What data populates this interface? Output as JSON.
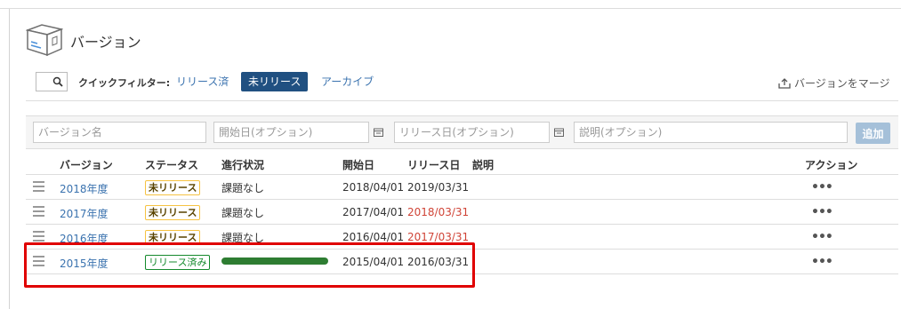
{
  "header": {
    "title": "バージョン",
    "icon": "box-icon"
  },
  "filter": {
    "label": "クイックフィルター:",
    "options": [
      {
        "label": "リリース済",
        "active": false
      },
      {
        "label": "未リリース",
        "active": true
      },
      {
        "label": "アーカイブ",
        "active": false
      }
    ]
  },
  "merge_label": "バージョンをマージ",
  "add_form": {
    "name_placeholder": "バージョン名",
    "start_placeholder": "開始日(オプション)",
    "release_placeholder": "リリース日(オプション)",
    "desc_placeholder": "説明(オプション)",
    "add_label": "追加"
  },
  "table": {
    "headers": [
      "バージョン",
      "ステータス",
      "進行状況",
      "開始日",
      "リリース日",
      "説明",
      "アクション"
    ],
    "rows": [
      {
        "version": "2018年度",
        "status": "未リリース",
        "progress": "課題なし",
        "start": "2018/04/01",
        "release": "2019/03/31",
        "release_overdue": false,
        "desc": "",
        "actions": "•••"
      },
      {
        "version": "2017年度",
        "status": "未リリース",
        "progress": "課題なし",
        "start": "2017/04/01",
        "release": "2018/03/31",
        "release_overdue": true,
        "desc": "",
        "actions": "•••"
      },
      {
        "version": "2016年度",
        "status": "未リリース",
        "progress": "課題なし",
        "start": "2016/04/01",
        "release": "2017/03/31",
        "release_overdue": true,
        "desc": "",
        "actions": "•••"
      },
      {
        "version": "2015年度",
        "status": "リリース済み",
        "progress_fraction": 1.0,
        "start": "2015/04/01",
        "release": "2016/03/31",
        "release_overdue": false,
        "desc": "",
        "actions": "•••"
      }
    ]
  },
  "colors": {
    "link": "#3b73af",
    "active_filter": "#205081",
    "overdue": "#d04437",
    "progress": "#2e7d32",
    "highlight": "#e00000"
  }
}
